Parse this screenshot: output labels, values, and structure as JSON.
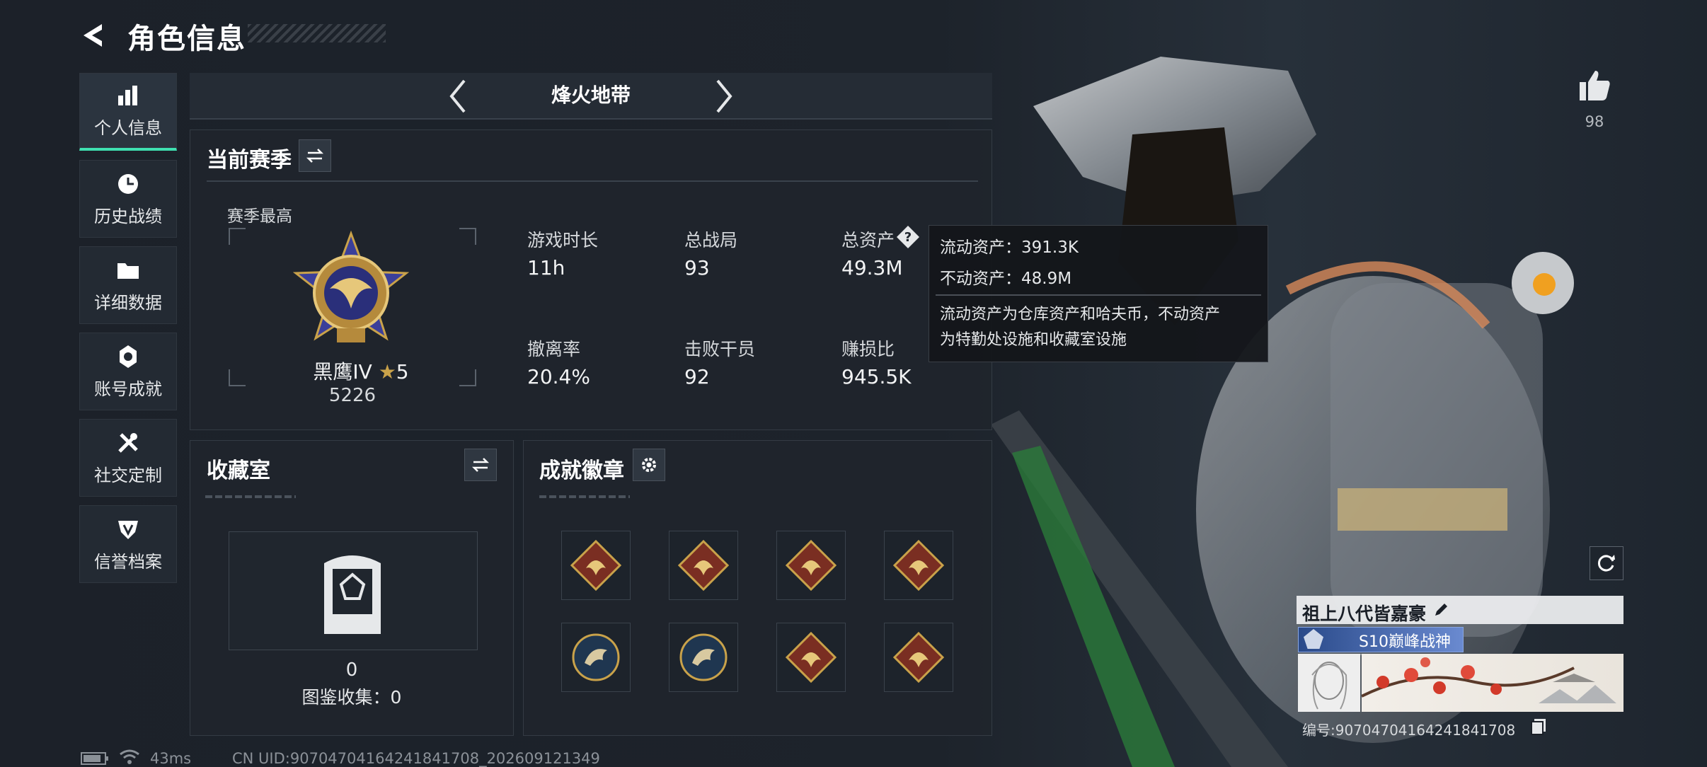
{
  "header": {
    "title": "角色信息"
  },
  "sidebar": {
    "items": [
      {
        "label": "个人信息",
        "icon": "bar-chart-icon",
        "active": true
      },
      {
        "label": "历史战绩",
        "icon": "clock-icon",
        "active": false
      },
      {
        "label": "详细数据",
        "icon": "folder-icon",
        "active": false
      },
      {
        "label": "账号成就",
        "icon": "medal-icon",
        "active": false
      },
      {
        "label": "社交定制",
        "icon": "tools-icon",
        "active": false
      },
      {
        "label": "信誉档案",
        "icon": "shield-icon",
        "active": false
      }
    ]
  },
  "mode_tab": {
    "label": "烽火地带"
  },
  "season": {
    "title": "当前赛季",
    "best_label": "赛季最高",
    "rank_name": "黑鹰IV",
    "rank_stars": "5",
    "rank_points": "5226",
    "stats": [
      {
        "label": "游戏时长",
        "value": "11h"
      },
      {
        "label": "总战局",
        "value": "93"
      },
      {
        "label": "总资产",
        "value": "49.3M"
      },
      {
        "label": "撤离率",
        "value": "20.4%"
      },
      {
        "label": "击败干员",
        "value": "92"
      },
      {
        "label": "赚损比",
        "value": "945.5K"
      }
    ]
  },
  "tooltip": {
    "liquid": "流动资产：391.3K",
    "fixed": "不动资产：48.9M",
    "desc_line1": "流动资产为仓库资产和哈夫币，不动资产",
    "desc_line2": "为特勤处设施和收藏室设施"
  },
  "collection": {
    "title": "收藏室",
    "count": "0",
    "catalog": "图鉴收集：0"
  },
  "achievements": {
    "title": "成就徽章",
    "badges": [
      {
        "shape": "diamond",
        "icon": "eagle-badge-icon"
      },
      {
        "shape": "diamond",
        "icon": "eagle-badge-icon"
      },
      {
        "shape": "diamond",
        "icon": "eagle-badge-icon"
      },
      {
        "shape": "diamond",
        "icon": "eagle-badge-icon"
      },
      {
        "shape": "circle",
        "icon": "eagle-head-badge-icon"
      },
      {
        "shape": "circle",
        "icon": "eagle-head-badge-icon"
      },
      {
        "shape": "diamond",
        "icon": "eagle-badge-icon"
      },
      {
        "shape": "diamond",
        "icon": "wing-badge-icon"
      }
    ]
  },
  "likes": {
    "count": "98"
  },
  "player_card": {
    "name": "祖上八代皆嘉豪",
    "title": "S10巅峰战神",
    "id_text": "编号:9070470416424184170​8"
  },
  "footer": {
    "ping": "43ms",
    "uid": "CN UID:9070470416424184170​8_202609121349"
  },
  "colors": {
    "accent": "#3fe0b0",
    "panel": "#1f252d",
    "gold": "#c9a24a"
  }
}
